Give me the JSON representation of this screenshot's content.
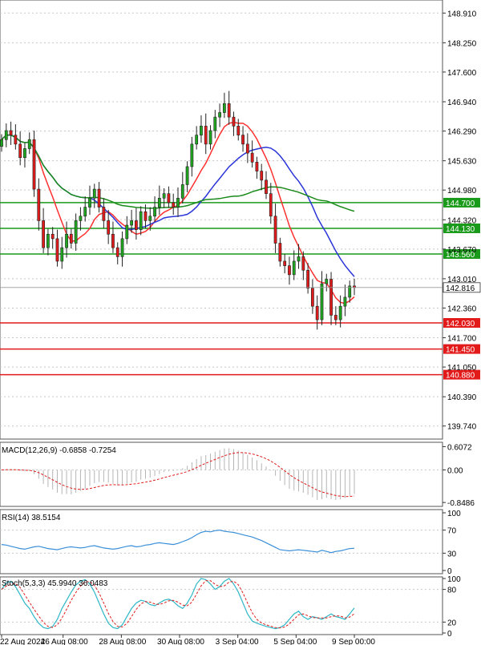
{
  "chart_data": {
    "type": "candlestick",
    "instrument_timeframe": "",
    "price_axis": {
      "range": [
        139.45,
        149.2
      ],
      "ticks": [
        "148.910",
        "148.250",
        "147.600",
        "146.940",
        "146.290",
        "145.630",
        "144.980",
        "144.320",
        "143.670",
        "143.010",
        "142.360",
        "141.700",
        "141.050",
        "140.390",
        "139.740"
      ],
      "current_price": "142.816"
    },
    "time_axis": {
      "labels": [
        "22 Aug 2024",
        "26 Aug 08:00",
        "28 Aug 08:00",
        "30 Aug 08:00",
        "3 Sep 04:00",
        "5 Sep 04:00",
        "9 Sep 00:00"
      ],
      "label_index": [
        0,
        19,
        37,
        55,
        73,
        91,
        109
      ]
    },
    "levels": [
      {
        "value": 144.7,
        "label": "144.700",
        "color": "#1a9a1a"
      },
      {
        "value": 144.13,
        "label": "144.130",
        "color": "#1a9a1a"
      },
      {
        "value": 143.56,
        "label": "143.560",
        "color": "#1a9a1a"
      },
      {
        "value": 142.03,
        "label": "142.030",
        "color": "#e31a1a"
      },
      {
        "value": 141.45,
        "label": "141.450",
        "color": "#e31a1a"
      },
      {
        "value": 140.88,
        "label": "140.880",
        "color": "#e31a1a"
      }
    ],
    "close": [
      146.1,
      146.3,
      146.2,
      146.0,
      145.7,
      145.9,
      146.1,
      145.0,
      144.3,
      143.7,
      144.0,
      143.9,
      143.4,
      143.7,
      144.0,
      143.8,
      144.3,
      144.4,
      144.6,
      144.8,
      145.0,
      144.6,
      144.3,
      144.0,
      143.7,
      143.5,
      143.9,
      144.2,
      144.3,
      144.1,
      144.5,
      144.3,
      144.4,
      144.6,
      144.8,
      144.9,
      144.7,
      144.6,
      144.8,
      145.1,
      145.5,
      146.0,
      146.2,
      146.4,
      146.0,
      146.3,
      146.6,
      146.7,
      146.9,
      146.6,
      146.4,
      146.2,
      146.0,
      145.8,
      145.6,
      145.4,
      145.2,
      144.9,
      144.4,
      143.8,
      143.4,
      143.3,
      143.1,
      143.4,
      143.5,
      143.2,
      142.8,
      142.4,
      142.1,
      142.9,
      143.0,
      142.2,
      142.1,
      142.4,
      142.6,
      142.85,
      142.816
    ],
    "moving_averages": [
      {
        "color": "#ff3030",
        "window": 8
      },
      {
        "color": "#2a35d8",
        "window": 20
      },
      {
        "color": "#1a8a1a",
        "window": 45
      }
    ],
    "macd": {
      "label": "MACD(12,26,9) -0.6858 -0.7254",
      "ticks": [
        "0.6072",
        "0.00",
        "-0.8486"
      ],
      "range": [
        -0.95,
        0.72
      ]
    },
    "rsi": {
      "label": "RSI(14) 38.5154",
      "ticks": [
        "100",
        "70",
        "30",
        "0"
      ],
      "range": [
        0,
        100
      ],
      "values": [
        45,
        44,
        42,
        40,
        38,
        37,
        39,
        41,
        42,
        40,
        38,
        37,
        36,
        38,
        40,
        41,
        40,
        39,
        40,
        42,
        43,
        41,
        39,
        38,
        37,
        38,
        40,
        42,
        43,
        41,
        42,
        44,
        45,
        47,
        48,
        47,
        46,
        45,
        47,
        50,
        53,
        57,
        62,
        66,
        68,
        67,
        69,
        70,
        68,
        67,
        66,
        64,
        62,
        60,
        58,
        55,
        52,
        48,
        44,
        40,
        36,
        35,
        34,
        35,
        36,
        35,
        34,
        33,
        32,
        35,
        33,
        31,
        33,
        34,
        36,
        38,
        38.5
      ]
    },
    "stoch": {
      "label": "Stoch(5,3,3) 45.9940 36.0483",
      "ticks": [
        "100",
        "80",
        "20",
        "0"
      ],
      "range": [
        0,
        100
      ],
      "k": [
        80,
        92,
        95,
        85,
        70,
        55,
        45,
        30,
        18,
        10,
        8,
        12,
        25,
        45,
        60,
        75,
        88,
        95,
        98,
        90,
        75,
        55,
        35,
        18,
        10,
        8,
        15,
        30,
        45,
        55,
        60,
        58,
        52,
        50,
        55,
        60,
        62,
        58,
        50,
        45,
        55,
        70,
        90,
        100,
        98,
        90,
        80,
        85,
        95,
        100,
        90,
        75,
        55,
        35,
        22,
        18,
        15,
        12,
        10,
        8,
        10,
        15,
        25,
        35,
        40,
        30,
        25,
        30,
        28,
        25,
        30,
        35,
        30,
        28,
        25,
        35,
        46
      ]
    }
  }
}
